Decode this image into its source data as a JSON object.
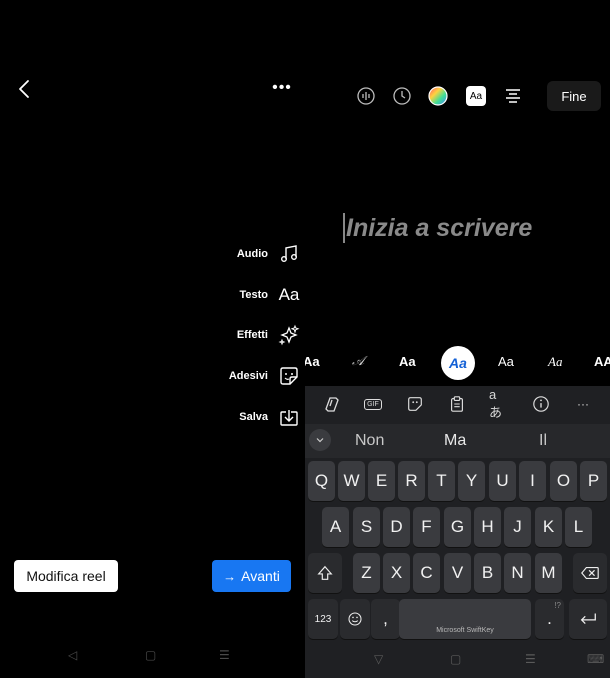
{
  "left": {
    "more_label": "•••",
    "tools": [
      {
        "label": "Audio",
        "icon": "music-note-icon"
      },
      {
        "label": "Testo",
        "icon": "text-aa-icon"
      },
      {
        "label": "Effetti",
        "icon": "sparkles-icon"
      },
      {
        "label": "Adesivi",
        "icon": "sticker-icon"
      },
      {
        "label": "Salva",
        "icon": "download-icon"
      }
    ],
    "text_icon_glyph": "Aa",
    "modifica_label": "Modifica reel",
    "avanti_label": "Avanti",
    "avanti_arrow": "→",
    "nav": {
      "back": "◁",
      "home": "▢",
      "recents": "☰"
    }
  },
  "right": {
    "topbar": {
      "text_style_glyph": "Aa",
      "done_label": "Fine"
    },
    "placeholder": "Inizia a scrivere",
    "fonts": [
      "Aa",
      "𝒜",
      "Aa",
      "Aa",
      "Aa",
      "Aa",
      "AA"
    ],
    "selected_font_index": 3,
    "keyboard": {
      "toolbar": {
        "gif": "GIF",
        "translate": "aあ",
        "more": "···"
      },
      "suggestions": [
        "Non",
        "Ma",
        "Il"
      ],
      "row1": [
        "Q",
        "W",
        "E",
        "R",
        "T",
        "Y",
        "U",
        "I",
        "O",
        "P"
      ],
      "row2": [
        "A",
        "S",
        "D",
        "F",
        "G",
        "H",
        "J",
        "K",
        "L"
      ],
      "row3": [
        "Z",
        "X",
        "C",
        "V",
        "B",
        "N",
        "M"
      ],
      "numbers_key": "123",
      "comma_key": ",",
      "period_key": ".",
      "space_label": "Microsoft SwiftKey",
      "alt_symbols": "!?",
      "nav": {
        "back": "▽",
        "home": "▢",
        "recents": "☰",
        "keyboard": "⌨"
      }
    }
  },
  "colors": {
    "accent": "#1877f2",
    "selected_font_text": "#1461d6",
    "keyboard_bg": "#1f2023",
    "key_bg": "#3a3b3f"
  }
}
